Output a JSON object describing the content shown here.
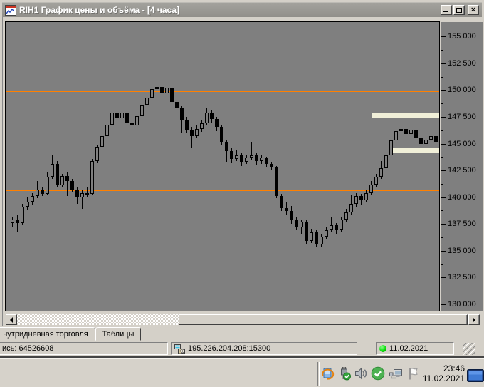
{
  "window": {
    "title": "RIH1 График цены и объёма - [4 часа]",
    "icon": "chart-window-icon",
    "controls": [
      "minimize",
      "maximize",
      "close"
    ]
  },
  "tabs": [
    {
      "label": "нутридневная торговля",
      "active": true
    },
    {
      "label": "Таблицы",
      "active": false
    }
  ],
  "statusbar": {
    "record_text": "ись: 64526608",
    "server_address": "195.226.204.208:15300",
    "session_date": "11.02.2021",
    "led_color": "#00d800"
  },
  "taskbar": {
    "time": "23:46",
    "date": "11.02.2021",
    "tray_icons": [
      {
        "name": "sync-icon"
      },
      {
        "name": "usb-device-icon"
      },
      {
        "name": "volume-icon"
      },
      {
        "name": "protection-ok-icon"
      },
      {
        "name": "network-connection-icon"
      },
      {
        "name": "flag-icon"
      }
    ]
  },
  "colors": {
    "chrome": "#d4d0c8",
    "titlebar": "#9a9893",
    "chart_bg": "#7f7f7f",
    "candle": "#000000",
    "level_line": "#ff8000",
    "band": "#f0efd8"
  },
  "chart_data": {
    "type": "candlestick",
    "instrument": "RIH1",
    "chart_title": "График цены и объёма",
    "timeframe": "4 часа",
    "y_axis": {
      "range": [
        129400,
        156350
      ],
      "minor_step": 1250,
      "ticks": [
        {
          "value": 155000,
          "label": "155 000"
        },
        {
          "value": 152500,
          "label": "152 500"
        },
        {
          "value": 150000,
          "label": "150 000"
        },
        {
          "value": 147500,
          "label": "147 500"
        },
        {
          "value": 145000,
          "label": "145 000"
        },
        {
          "value": 142500,
          "label": "142 500"
        },
        {
          "value": 140000,
          "label": "140 000"
        },
        {
          "value": 137500,
          "label": "137 500"
        },
        {
          "value": 135000,
          "label": "135 000"
        },
        {
          "value": 132500,
          "label": "132 500"
        },
        {
          "value": 130000,
          "label": "130 000"
        }
      ]
    },
    "levels": [
      {
        "value": 149900,
        "color": "#ff8000"
      },
      {
        "value": 140650,
        "color": "#ff8000"
      }
    ],
    "bands": [
      {
        "value": 147620,
        "x0_frac": 0.845,
        "x1_frac": 1.0,
        "color": "#f0efd8"
      },
      {
        "value": 144430,
        "x0_frac": 0.886,
        "x1_frac": 1.0,
        "color": "#f0efd8"
      }
    ],
    "candles": [
      [
        137600,
        138200,
        137200,
        137900
      ],
      [
        137900,
        138300,
        136800,
        137600
      ],
      [
        137600,
        139400,
        137400,
        139100
      ],
      [
        139100,
        140000,
        138800,
        139600
      ],
      [
        139600,
        140400,
        139300,
        140100
      ],
      [
        140100,
        141500,
        139900,
        140700
      ],
      [
        140700,
        141000,
        140100,
        140300
      ],
      [
        140300,
        142300,
        140200,
        141900
      ],
      [
        141900,
        143900,
        141700,
        143100
      ],
      [
        143100,
        143400,
        140900,
        141100
      ],
      [
        141100,
        142200,
        140900,
        142000
      ],
      [
        142000,
        142300,
        140100,
        141500
      ],
      [
        141500,
        141700,
        140500,
        140700
      ],
      [
        140700,
        140900,
        139400,
        140000
      ],
      [
        140000,
        140700,
        138900,
        140400
      ],
      [
        140400,
        140900,
        140000,
        140300
      ],
      [
        140300,
        143600,
        140200,
        143400
      ],
      [
        143400,
        144900,
        143200,
        144700
      ],
      [
        144700,
        146300,
        144500,
        145700
      ],
      [
        145700,
        147100,
        145400,
        146800
      ],
      [
        146800,
        148600,
        146600,
        147900
      ],
      [
        147900,
        148200,
        147100,
        147400
      ],
      [
        147400,
        148300,
        147200,
        147900
      ],
      [
        147900,
        148100,
        146800,
        147000
      ],
      [
        147000,
        147400,
        146300,
        146700
      ],
      [
        146700,
        150300,
        146500,
        147600
      ],
      [
        147600,
        148900,
        147400,
        148600
      ],
      [
        148600,
        149600,
        148300,
        149300
      ],
      [
        149300,
        150800,
        149100,
        150100
      ],
      [
        150100,
        150900,
        149700,
        150300
      ],
      [
        150300,
        150500,
        149300,
        149700
      ],
      [
        149700,
        150700,
        149500,
        150200
      ],
      [
        150200,
        150400,
        148700,
        148900
      ],
      [
        148900,
        149200,
        147900,
        148300
      ],
      [
        148300,
        148500,
        146000,
        147200
      ],
      [
        147200,
        147500,
        146000,
        146300
      ],
      [
        146300,
        146600,
        144600,
        145700
      ],
      [
        145700,
        146700,
        145500,
        146400
      ],
      [
        146400,
        147200,
        146100,
        146900
      ],
      [
        146900,
        148300,
        146700,
        147900
      ],
      [
        147900,
        148100,
        147000,
        147300
      ],
      [
        147300,
        147500,
        146200,
        146600
      ],
      [
        146600,
        146800,
        144900,
        145200
      ],
      [
        145200,
        145400,
        143300,
        144300
      ],
      [
        144300,
        144600,
        143200,
        143600
      ],
      [
        143600,
        144400,
        143400,
        143900
      ],
      [
        143900,
        144100,
        142900,
        143300
      ],
      [
        143300,
        144000,
        143100,
        143700
      ],
      [
        143700,
        145200,
        143500,
        143900
      ],
      [
        143900,
        144100,
        143000,
        143400
      ],
      [
        143400,
        143900,
        143100,
        143700
      ],
      [
        143700,
        143800,
        142800,
        143100
      ],
      [
        143100,
        143300,
        142500,
        142800
      ],
      [
        142800,
        142900,
        139900,
        140100
      ],
      [
        140100,
        140300,
        138700,
        139000
      ],
      [
        139000,
        139600,
        138400,
        138700
      ],
      [
        138700,
        139200,
        137500,
        137900
      ],
      [
        137900,
        138200,
        136900,
        137200
      ],
      [
        137200,
        137900,
        136500,
        137700
      ],
      [
        137700,
        137900,
        135600,
        135900
      ],
      [
        135900,
        137000,
        135700,
        136700
      ],
      [
        136700,
        136900,
        135300,
        135600
      ],
      [
        135600,
        136600,
        135400,
        136300
      ],
      [
        136300,
        137200,
        136100,
        136900
      ],
      [
        136900,
        138100,
        136700,
        137400
      ],
      [
        137400,
        137600,
        136500,
        136900
      ],
      [
        136900,
        138100,
        136800,
        137900
      ],
      [
        137900,
        138900,
        137700,
        138600
      ],
      [
        138600,
        140200,
        138400,
        139400
      ],
      [
        139400,
        140400,
        139100,
        140100
      ],
      [
        140100,
        140300,
        139300,
        139700
      ],
      [
        139700,
        140700,
        139500,
        140400
      ],
      [
        140400,
        141500,
        140200,
        141200
      ],
      [
        141200,
        142200,
        141000,
        141900
      ],
      [
        141900,
        143400,
        141700,
        142700
      ],
      [
        142700,
        144100,
        142500,
        143900
      ],
      [
        143900,
        145600,
        143700,
        145300
      ],
      [
        145300,
        147600,
        145100,
        146200
      ],
      [
        146200,
        146800,
        145700,
        146400
      ],
      [
        146400,
        146600,
        145500,
        145900
      ],
      [
        145900,
        146900,
        145600,
        146300
      ],
      [
        146300,
        146500,
        145200,
        145600
      ],
      [
        145600,
        145800,
        144300,
        145000
      ],
      [
        145000,
        145700,
        144800,
        145400
      ],
      [
        145400,
        146000,
        145100,
        145700
      ],
      [
        145700,
        145900,
        144900,
        145200
      ]
    ]
  }
}
